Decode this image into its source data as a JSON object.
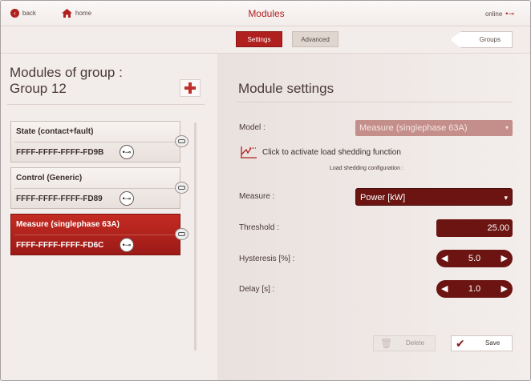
{
  "topbar": {
    "back_label": "back",
    "home_label": "home",
    "title": "Modules",
    "status": "online"
  },
  "tabs": {
    "settings": "Settings",
    "advanced": "Advanced"
  },
  "groups_button": "Groups",
  "left": {
    "heading_line1": "Modules of group :",
    "heading_line2": "Group 12",
    "modules": [
      {
        "name": "State (contact+fault)",
        "id": "FFFF-FFFF-FFFF-FD9B",
        "active": false
      },
      {
        "name": "Control (Generic)",
        "id": "FFFF-FFFF-FFFF-FD89",
        "active": false
      },
      {
        "name": "Measure (singlephase 63A)",
        "id": "FFFF-FFFF-FFFF-FD6C",
        "active": true
      }
    ]
  },
  "settings": {
    "title": "Module settings",
    "model_label": "Model :",
    "model_value": "Measure (singlephase 63A)",
    "load_shedding_text": "Click to activate load shedding function",
    "load_shedding_config": "Load shedding configuration :",
    "measure_label": "Measure :",
    "measure_value": "Power [kW]",
    "threshold_label": "Threshold :",
    "threshold_value": "25.00",
    "hysteresis_label": "Hysteresis [%] :",
    "hysteresis_value": "5.0",
    "delay_label": "Delay [s] :",
    "delay_value": "1.0"
  },
  "actions": {
    "delete": "Delete",
    "save": "Save"
  },
  "colors": {
    "accent": "#b0201e",
    "dark_control": "#6b1412"
  }
}
